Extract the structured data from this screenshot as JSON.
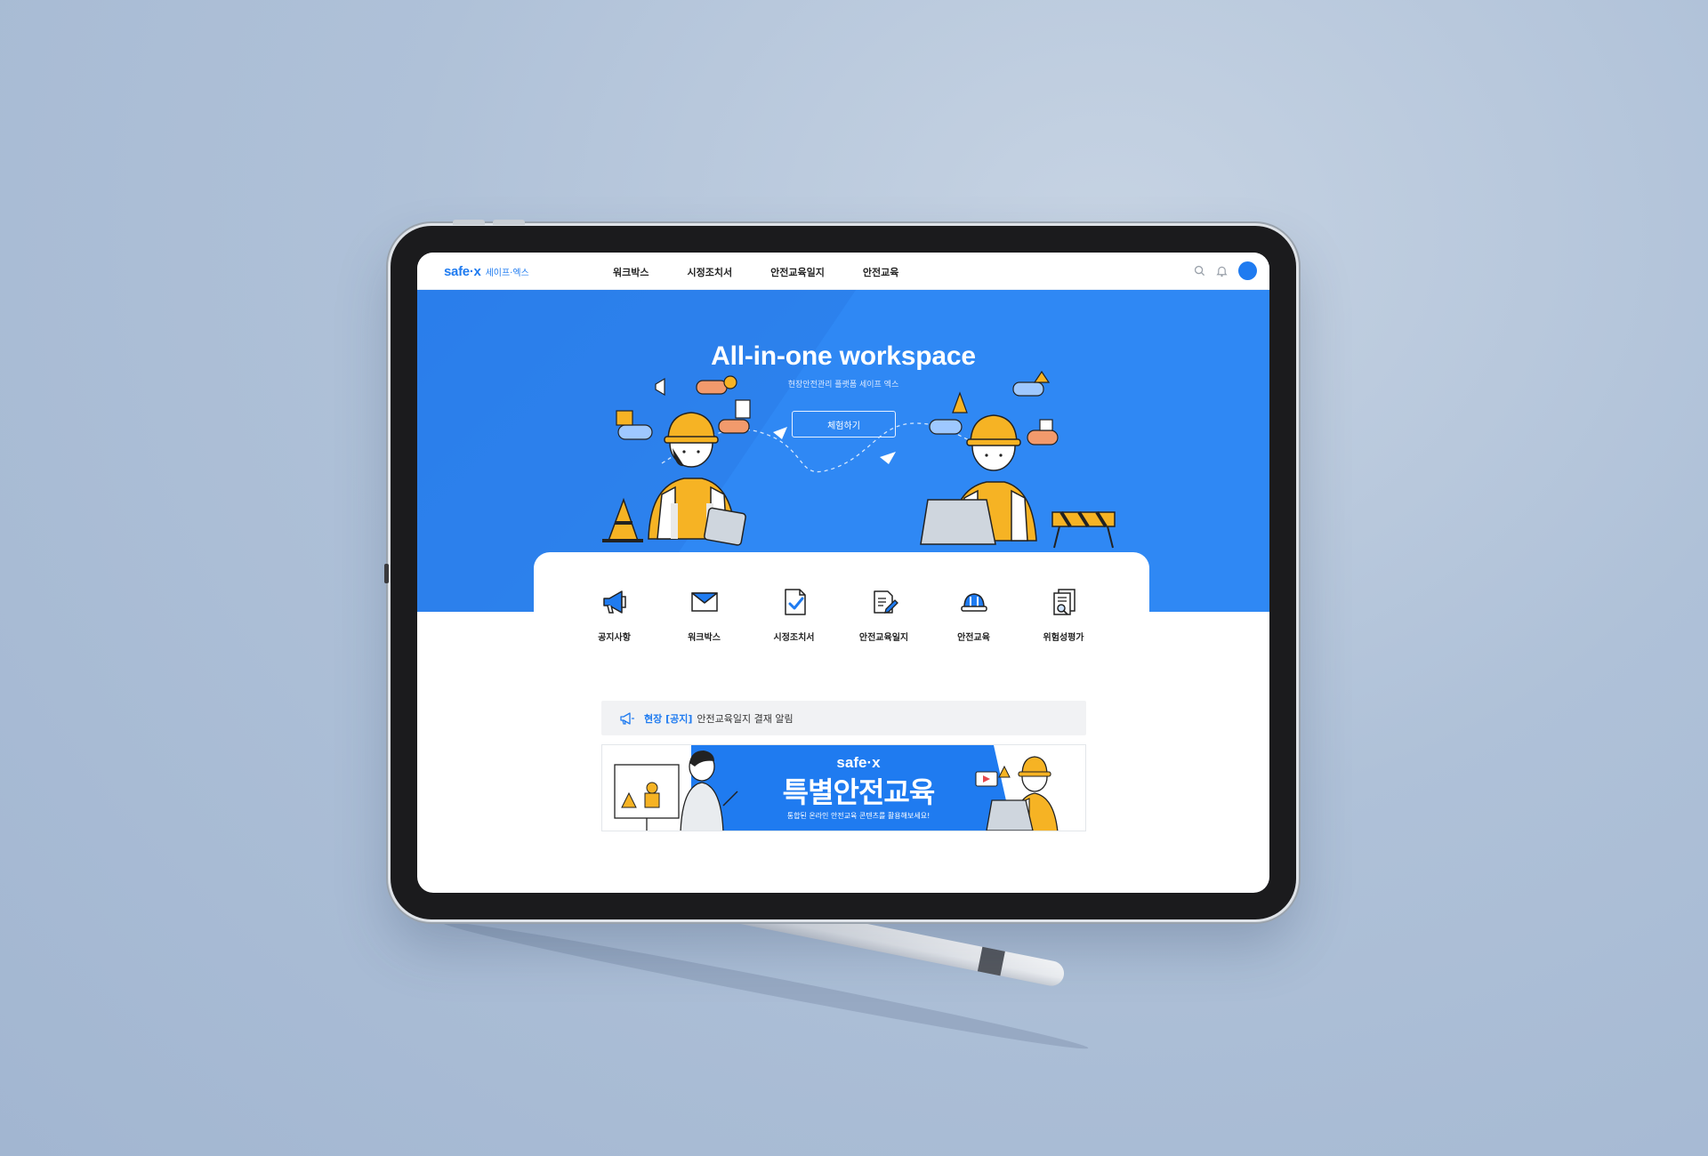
{
  "header": {
    "logo_en": "safe·x",
    "logo_ko": "세이프·엑스",
    "nav": [
      "워크박스",
      "시정조치서",
      "안전교육일지",
      "안전교육"
    ]
  },
  "hero": {
    "title": "All-in-one workspace",
    "subtitle": "현장안전관리 플랫폼 세이프 엑스",
    "cta_label": "체험하기"
  },
  "quick_menu": [
    {
      "label": "공지사항",
      "icon": "megaphone-icon"
    },
    {
      "label": "워크박스",
      "icon": "envelope-icon"
    },
    {
      "label": "시정조치서",
      "icon": "document-check-icon"
    },
    {
      "label": "안전교육일지",
      "icon": "document-pen-icon"
    },
    {
      "label": "안전교육",
      "icon": "hard-hat-icon"
    },
    {
      "label": "위험성평가",
      "icon": "document-search-icon"
    }
  ],
  "notice": {
    "tag": "현장 [공지]",
    "text": "안전교육일지 결재 알림"
  },
  "banner": {
    "brand": "safe·x",
    "title": "특별안전교육",
    "subtitle": "통합된 온라인 안전교육 콘텐츠를 활용해보세요!"
  },
  "colors": {
    "brand_blue": "#1f7bf0",
    "hero_blue": "#2f88f4",
    "background": "#adc0d8",
    "bezel": "#1b1b1d"
  }
}
